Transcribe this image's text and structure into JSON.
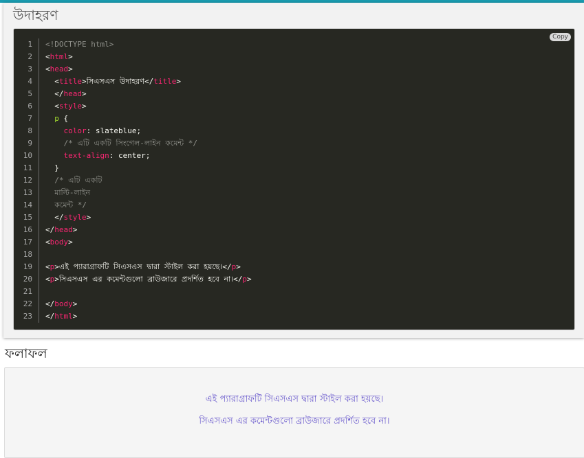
{
  "example": {
    "title": "উদাহরণ",
    "copy_label": "Copy",
    "line_numbers": [
      "1",
      "2",
      "3",
      "4",
      "5",
      "6",
      "7",
      "8",
      "9",
      "10",
      "11",
      "12",
      "13",
      "14",
      "15",
      "16",
      "17",
      "18",
      "19",
      "20",
      "21",
      "22",
      "23"
    ],
    "code": {
      "l1": "<!DOCTYPE html>",
      "l2_tag": "html",
      "l3_tag": "head",
      "l4_tag": "title",
      "l4_text": "সিএসএস উদাহরণ",
      "l5_tag": "head",
      "l6_tag": "style",
      "l7_sel": "p",
      "l8_prop": "color",
      "l8_val": "slateblue;",
      "l9_cmt": "/* এটি একটি সিংগেল-লাইন কমেন্ট */",
      "l10_prop": "text-align",
      "l10_val": "center;",
      "l12_cmt": "/* এটি একটি",
      "l13_cmt": "মাল্টি-লাইন",
      "l14_cmt": "কমেন্ট */",
      "l15_tag": "style",
      "l16_tag": "head",
      "l17_tag": "body",
      "l19_tag": "p",
      "l19_text": "এই প্যারাগ্রাফটি সিএসএস দ্বারা স্টাইল করা হয়ছে।",
      "l20_tag": "p",
      "l20_text": "সিএসএস এর কমেন্টগুলো ব্রাউজারে প্রদর্শিত হবে না।",
      "l22_tag": "body",
      "l23_tag": "html"
    }
  },
  "result": {
    "heading": "ফলাফল",
    "p1": "এই প্যারাগ্রাফটি সিএসএস দ্বারা স্টাইল করা হয়ছে।",
    "p2": "সিএসএস এর কমেন্টগুলো ব্রাউজারে প্রদর্শিত হবে না।"
  },
  "colors": {
    "accent_strip": "#1a9bb0",
    "editor_bg": "#272822",
    "tag": "#f92672",
    "selector": "#a6e22e",
    "comment": "#8f908a",
    "result_text": "#6a5acd"
  }
}
